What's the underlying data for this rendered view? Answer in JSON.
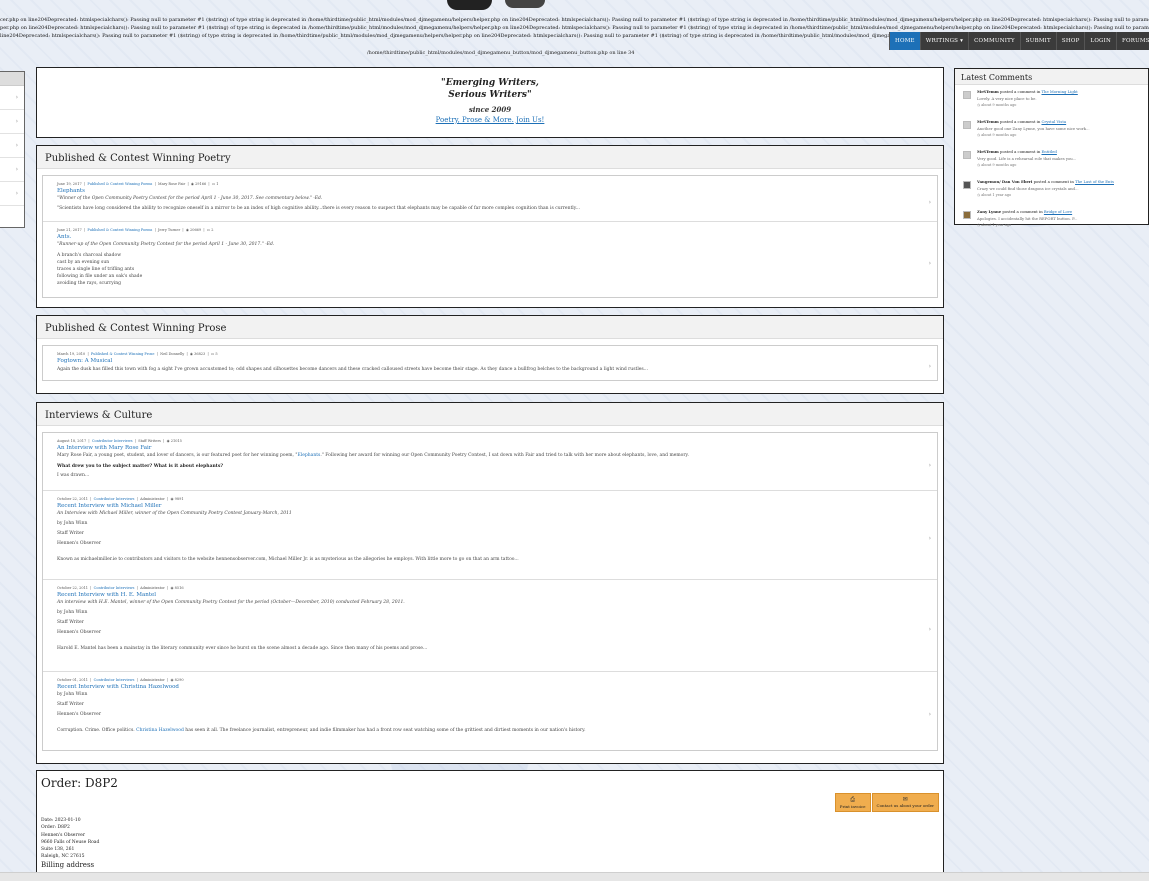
{
  "warnings": {
    "line1": "cer.php on line204Deprecated: htmlspecialchars(): Passing null to parameter #1 ($string) of type string is deprecated in /home/thirdtime/public_html/modules/mod_djmegamenu/helpers/helper.php on line204Deprecated: htmlspecialchars(): Passing null to parameter #1 ($string) of type string is deprecated in /home/thirdtime/public_html/modules/mod_djmegamenu/helpers/helper.php on line204Deprecated: htmlspecialchars(): Passing null to parameter #1 ($string) of type string is deprecated in /home/thirdtime/public_html/modules/mod_djmegamenu/helpers/helper.php on line204Deprecated: htmlspecialchars(): Passing null to parameter #1 ($string) of type string is deprecated in /home/thirdtime/public_html/modules/mod_djmegamenu/helpers/helper.php on line204",
    "line2": "per.php on line204Deprecated: htmlspecialchars(): Passing null to parameter #1 ($string) of type string is deprecated in /home/thirdtime/public_html/modules/mod_djmegamenu/helpers/helper.php on line204Deprecated: htmlspecialchars(): Passing null to parameter #1 ($string) of type string is deprecated in /home/thirdtime/public_html/modules/mod_djmegamenu/helpers/helper.php on line204Deprecated: htmlspecialchars(): Passing null to parameter #1 ($string) of type string is deprecated in /home/thirdtime/public_html/modules/mod_djmegamenu/helpers/helper.php on line204",
    "line3": "line204Deprecated: htmlspecialchars(): Passing null to parameter #1 ($string) of type string is deprecated in /home/thirdtime/public_html/modules/mod_djmegamenu/helpers/helper.php on line204Deprecated: htmlspecialchars(): Passing null to parameter #1 ($string) of type string is deprecated in /home/thirdtime/public_html/modules/mod_djmegamenu/helpers/helper.php on line204Deprecated: htmlspecialchars(): Passing null to parameter #1 ($string) of type string is deprecated in /home/thirdtime/public_html/modules/mod_djmegamenu/helpers/helper.php on line59",
    "path": "/home/thirdtime/public_html/modules/mod_djmegamenu_button/mod_djmegamenu_button.php on line 34"
  },
  "nav": {
    "home": "HOME",
    "writings": "WRITINGS",
    "community": "COMMUNITY",
    "submit": "SUBMIT",
    "shop": "SHOP",
    "login": "LOGIN",
    "forums": "FORUMS"
  },
  "hero": {
    "quote1": "\"Emerging Writers,",
    "quote2": "Serious Writers\"",
    "since": "since 2009",
    "link1": "Poetry, Prose & More.",
    "link2": "Join Us!"
  },
  "poetry": {
    "title": "Published & Contest Winning Poetry",
    "items": [
      {
        "date": "June 19, 2017",
        "category": "Published & Contest Winning Poems",
        "author": "Mary Rose Fair",
        "views": "29166",
        "comments": "1",
        "title": "Elephants",
        "subtitle": "\"Winner of the Open Community Poetry Contest for the period April 1 - June 30, 2017. See commentary below.\" -Ed.",
        "excerpt": "\"Scientists have long considered the ability to recognize oneself in a mirror to be an index of high cognitive ability...there is every reason to suspect that elephants may be capable of far more complex cognition than is currently..."
      },
      {
        "date": "June 21, 2017",
        "category": "Published & Contest Winning Poems",
        "author": "Jerry Turner",
        "views": "20669",
        "comments": "2",
        "title": "Ants.",
        "subtitle": "\"Runner-up of the Open Community Poetry Contest for the period April 1 - June 30, 2017.\" -Ed.",
        "lines": [
          "A branch's charcoal shadow",
          "cast by an evening sun",
          "traces a single line of trifling ants",
          "following in file under an oak's shade",
          "avoiding the rays, scurrying"
        ]
      }
    ]
  },
  "prose": {
    "title": "Published & Contest Winning Prose",
    "item": {
      "date": "March 19, 2010",
      "category": "Published & Contest Winning Prose",
      "author": "Neil Donnelly",
      "views": "36823",
      "comments": "5",
      "title": "Fogtown: A Musical",
      "excerpt": "Again the dusk has filled this town with fog a sight I've grown accustomed to; odd shapes and silhouettes become dancers and these cracked calloused streets have become their stage. As they dance a bullfrog belches to the background a light wind rustles..."
    }
  },
  "interviews": {
    "title": "Interviews & Culture",
    "items": [
      {
        "date": "August 18, 2017",
        "category": "Contributor Interviews",
        "author": "Staff Writers",
        "views": "21015",
        "title": "An Interview with Mary Rose Fair",
        "excerpt_pre": "Mary Rose Fair, a young poet, student, and lover of dancers, is our featured poet for her winning poem, \"",
        "excerpt_link": "Elephants",
        "excerpt_post": ".\" Following her award for winning our Open Community Poetry Contest, I sat down with Fair and tried to talk with her more about elephants, love, and memory.",
        "question": "What drew you to the subject matter? What is it about elephants?",
        "teaser": "I was drawn..."
      },
      {
        "date": "October 22, 2011",
        "category": "Contributor Interviews",
        "author": "Administrator",
        "views": "9891",
        "title": "Recent Interview with Michael Miller",
        "subtitle": "An Interview with Michael Miller, winner of the Open Community Poetry Contest January-March, 2011",
        "by": "by John Winn",
        "role": "Staff Writer",
        "org": "Hennen's Observer",
        "excerpt": "Known as michaelmiller.ie to contributors and visitors to the website hennensobserver.com, Michael Miller Jr. is as mysterious as the allegories he employs.  With little more to go on that an arm tattoo..."
      },
      {
        "date": "October 22, 2011",
        "category": "Contributor Interviews",
        "author": "Administrator",
        "views": "8516",
        "title": "Recent Interview with H. E. Mantel",
        "subtitle": "An interview with H.E. Mantel, winner of the Open Community Poetry Contest for the period (October—December, 2010) conducted February 28, 2011.",
        "by": "by John Winn",
        "role": "Staff Writer",
        "org": "Hennen's Observer",
        "excerpt": "Harold E. Mantel has been a mainstay in the literary community ever since he burst on the scene almost a decade ago. Since then many of his poems and prose..."
      },
      {
        "date": "October 01, 2011",
        "category": "Contributor Interviews",
        "author": "Administrator",
        "views": "8290",
        "title": "Recent Interview with Christina Hazelwood",
        "by": "by John Winn",
        "role": "Staff Writer",
        "org": "Hennen's Observer",
        "excerpt_pre": "Corruption. Crime. Office politics. ",
        "excerpt_link": "Christina Hazelwood",
        "excerpt_post": " has seen it all. The freelance  journalist, entrepreneur, and indie filmmaker has had a front row seat watching some of the grittiest and dirtiest moments in our nation's history."
      }
    ]
  },
  "sidebar": {
    "title": "Latest Comments",
    "comments": [
      {
        "user": "MrSTemm",
        "action": "posted a comment in",
        "target": "The Morning Light",
        "body": "Lovely. A very nice place to be.",
        "time": "about 9 months ago"
      },
      {
        "user": "MrSTemm",
        "action": "posted a comment in",
        "target": "Crystal Vista",
        "body": "Another good one Zany Lynne, you have some nice work...",
        "time": "about 9 months ago"
      },
      {
        "user": "MrSTemm",
        "action": "posted a comment in",
        "target": "Entitled",
        "body": "Very good. Life is a rehearsal role that makes you...",
        "time": "about 9 months ago"
      },
      {
        "user": "Vangemon/ Dan Von Eberi",
        "action": "posted a comment in",
        "target": "The Last of the Ents",
        "body": "Crazy we could find those dragons ice crystals and...",
        "time": "about 1 year ago"
      },
      {
        "user": "Zany Lynne",
        "action": "posted a comment in",
        "target": "Bridge of Love",
        "body": "Apologies. I accidentally hit the REPORT button. P...",
        "time": "about 1 year ago"
      }
    ]
  },
  "order": {
    "title": "Order: D8P2",
    "print_label": "Print invoice",
    "contact_label": "Contact us about your order",
    "lines": [
      "Date: 2023-01-10",
      "Order: D8P2",
      "Hennen's Observer",
      "9660 Falls of Neuse Road",
      "Suite 138, 261",
      "Raleigh, NC 27615"
    ],
    "billing": "Billing address"
  }
}
